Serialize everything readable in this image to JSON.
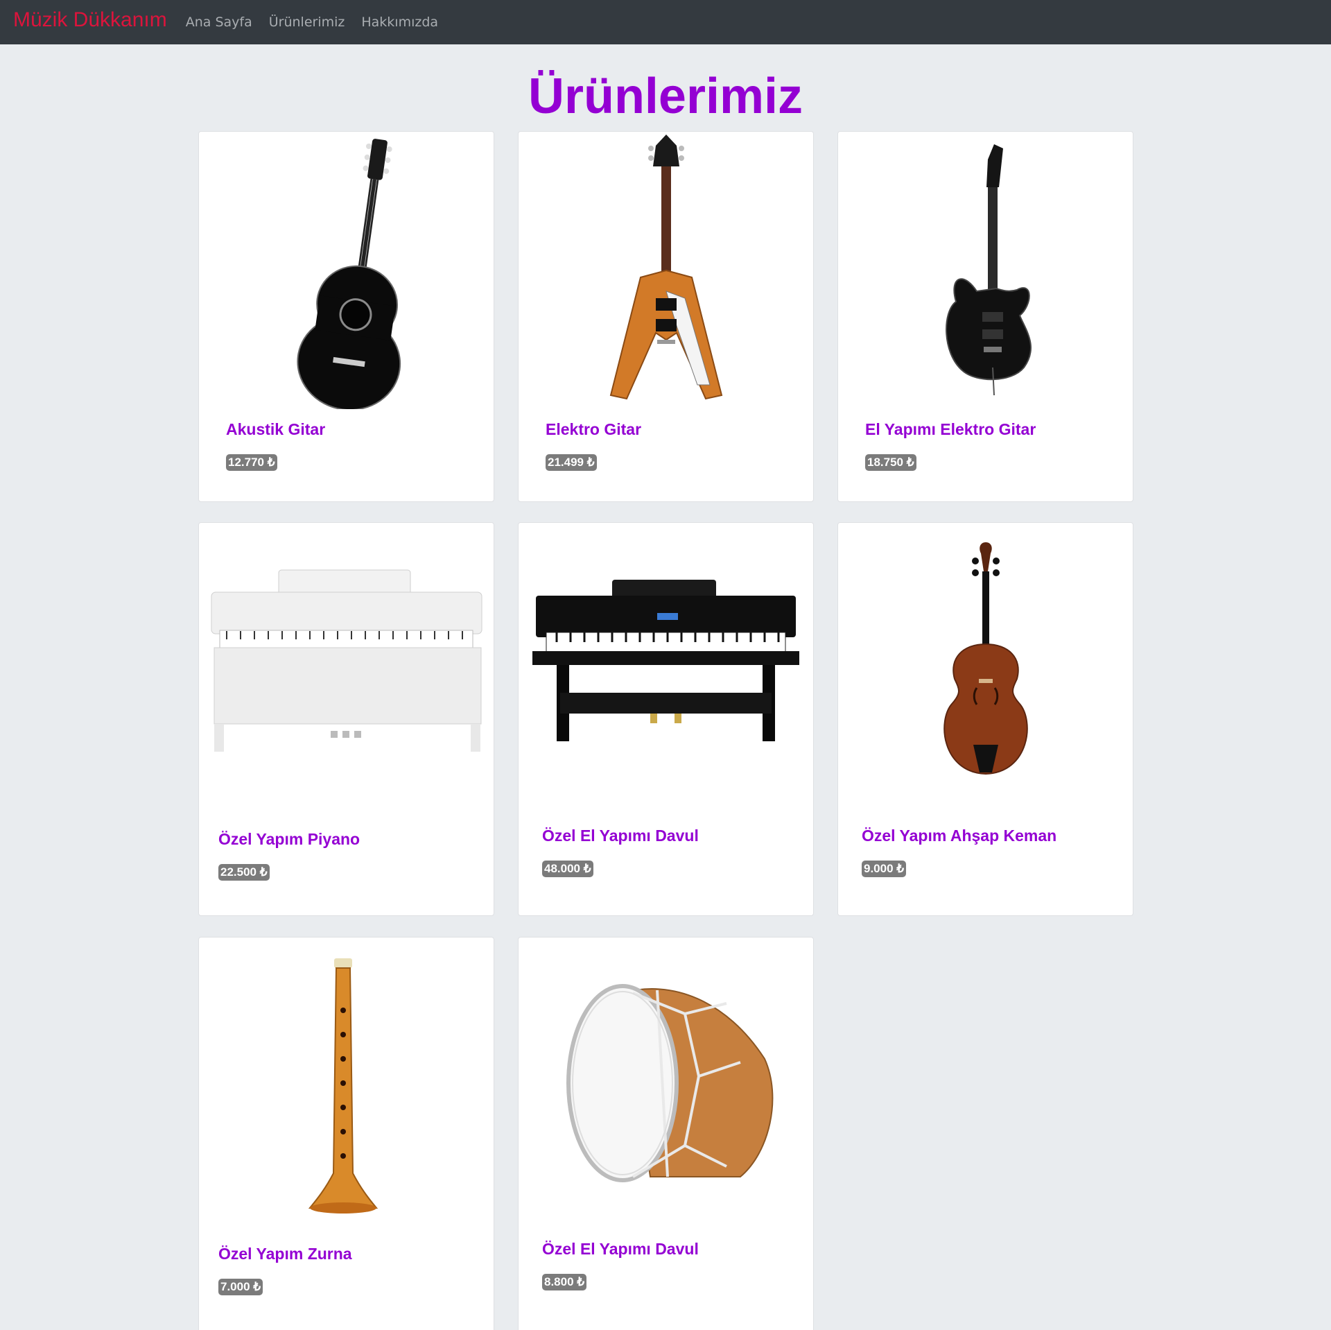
{
  "nav": {
    "brand": "Müzik Dükkanım",
    "links": [
      "Ana Sayfa",
      "Ürünlerimiz",
      "Hakkımızda"
    ]
  },
  "page": {
    "title": "Ürünlerimiz"
  },
  "products": [
    {
      "name": "Akustik Gitar",
      "price": "12.770 ₺",
      "image": "acoustic-guitar"
    },
    {
      "name": "Elektro Gitar",
      "price": "21.499 ₺",
      "image": "flying-v-guitar"
    },
    {
      "name": "El Yapımı Elektro Gitar",
      "price": "18.750 ₺",
      "image": "black-electric-guitar"
    },
    {
      "name": "Özel Yapım Piyano",
      "price": "22.500 ₺",
      "image": "white-digital-piano"
    },
    {
      "name": "Özel El Yapımı Davul",
      "price": "48.000 ₺",
      "image": "black-digital-piano"
    },
    {
      "name": "Özel Yapım Ahşap Keman",
      "price": "9.000 ₺",
      "image": "violin"
    },
    {
      "name": "Özel Yapım Zurna",
      "price": "7.000 ₺",
      "image": "zurna"
    },
    {
      "name": "Özel El Yapımı Davul",
      "price": "8.800 ₺",
      "image": "davul-drum"
    }
  ]
}
